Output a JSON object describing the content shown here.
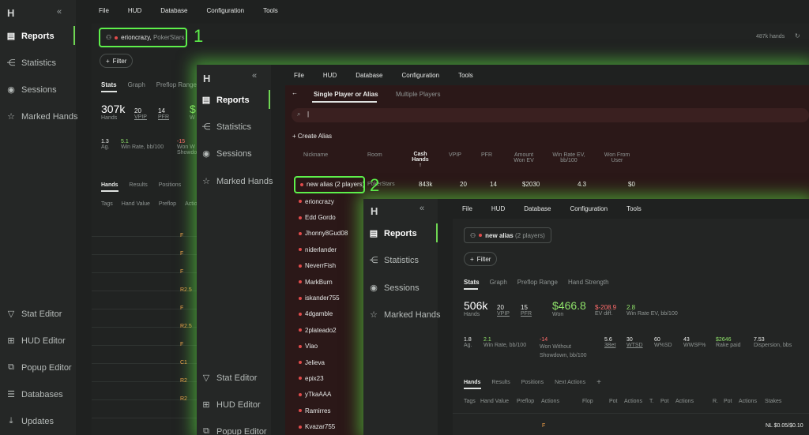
{
  "win1": {
    "logo": "H",
    "nav": [
      "Reports",
      "Statistics",
      "Sessions",
      "Marked Hands"
    ],
    "nav_bottom": [
      "Stat Editor",
      "HUD Editor",
      "Popup Editor",
      "Databases",
      "Updates"
    ],
    "menu": [
      "File",
      "HUD",
      "Database",
      "Configuration",
      "Tools"
    ],
    "player": "erioncrazy",
    "site": "PokerStars",
    "hands_total": "487k hands",
    "filter_label": "Filter",
    "tabs": [
      "Stats",
      "Graph",
      "Preflop Range"
    ],
    "stats_row1": [
      {
        "value": "307k",
        "label": "Hands",
        "underline": false
      },
      {
        "value": "20",
        "label": "VPIP",
        "underline": true
      },
      {
        "value": "14",
        "label": "PFR",
        "underline": true
      },
      {
        "value": "$",
        "label": "W",
        "underline": false
      }
    ],
    "stats_row2": [
      {
        "value": "1.3",
        "label": "Ag."
      },
      {
        "value": "5.1",
        "label": "Win Rate, bb/100"
      },
      {
        "value": "-15",
        "label": "Won W"
      },
      {
        "value": "",
        "label": "Showdo"
      }
    ],
    "hand_tabs": [
      "Hands",
      "Results",
      "Positions"
    ],
    "cols": [
      "Tags",
      "Hand Value",
      "Preflop",
      "Action"
    ],
    "actions": [
      "F",
      "F",
      "F",
      "R2.5",
      "F",
      "R2.5",
      "F",
      "C1",
      "R2",
      "R2"
    ]
  },
  "win2": {
    "logo": "H",
    "nav": [
      "Reports",
      "Statistics",
      "Sessions",
      "Marked Hands"
    ],
    "nav_bottom": [
      "Stat Editor",
      "HUD Editor",
      "Popup Editor"
    ],
    "menu": [
      "File",
      "HUD",
      "Database",
      "Configuration",
      "Tools"
    ],
    "tab_single": "Single Player or Alias",
    "tab_multi": "Multiple Players",
    "search_value": "|",
    "create_alias": "Create Alias",
    "cols": [
      "Nickname",
      "Room",
      "Cash Hands",
      "VPIP",
      "PFR",
      "Amount Won EV",
      "Win Rate EV, bb/100",
      "Won From User"
    ],
    "alias_row": {
      "name": "new alias (2 players)",
      "room": "PokerStars",
      "hands": "843k",
      "vpip": "20",
      "pfr": "14",
      "won_ev": "$2030",
      "winrate": "4.3",
      "won_user": "$0"
    },
    "players": [
      "erioncrazy",
      "Edd Gordo",
      "Jhonny8Gud08",
      "niderlander",
      "NeverrFish",
      "MarkBurn",
      "iskander755",
      "4dgamble",
      "2plateado2",
      "Vlao",
      "Jelieva",
      "epix23",
      "yTkaAAA",
      "Ramirres",
      "Kvazar755"
    ]
  },
  "win3": {
    "logo": "H",
    "nav": [
      "Reports",
      "Statistics",
      "Sessions",
      "Marked Hands"
    ],
    "menu": [
      "File",
      "HUD",
      "Database",
      "Configuration",
      "Tools"
    ],
    "alias": "new alias",
    "alias_count": "(2 players)",
    "filter_label": "Filter",
    "tabs": [
      "Stats",
      "Graph",
      "Preflop Range",
      "Hand Strength"
    ],
    "stats_row1": [
      {
        "value": "506k",
        "label": "Hands"
      },
      {
        "value": "20",
        "label": "VPIP"
      },
      {
        "value": "15",
        "label": "PFR"
      },
      {
        "value": "$466.8",
        "label": "Won"
      },
      {
        "value": "$-208.9",
        "label": "EV diff."
      },
      {
        "value": "2.8",
        "label": "Win Rate EV, bb/100"
      }
    ],
    "stats_row2": [
      {
        "value": "1.8",
        "label": "Ag."
      },
      {
        "value": "2.1",
        "label": "Win Rate, bb/100"
      },
      {
        "value": "-14",
        "label": "Won Without Showdown, bb/100"
      },
      {
        "value": "5.6",
        "label": "3Bet"
      },
      {
        "value": "30",
        "label": "WTSD"
      },
      {
        "value": "60",
        "label": "W%SD"
      },
      {
        "value": "43",
        "label": "WWSF%"
      },
      {
        "value": "$2646",
        "label": "Rake paid"
      },
      {
        "value": "7.53",
        "label": "Dispersion, bbs"
      }
    ],
    "hand_tabs": [
      "Hands",
      "Results",
      "Positions",
      "Next Actions",
      "+"
    ],
    "cols": [
      "Tags",
      "Hand Value",
      "Preflop",
      "Actions",
      "Flop",
      "Pot",
      "Actions",
      "T.",
      "Pot",
      "Actions",
      "R.",
      "Pot",
      "Actions",
      "Stakes"
    ],
    "first_action": "F",
    "stakes": "NL $0.05/$0.10"
  },
  "callouts": [
    "1",
    "2"
  ],
  "colors": {
    "accent_green": "#5ef04b",
    "win_green": "#8fe36a",
    "loss_red": "#ff6b6b",
    "preflop_orange": "#f3a24a"
  }
}
